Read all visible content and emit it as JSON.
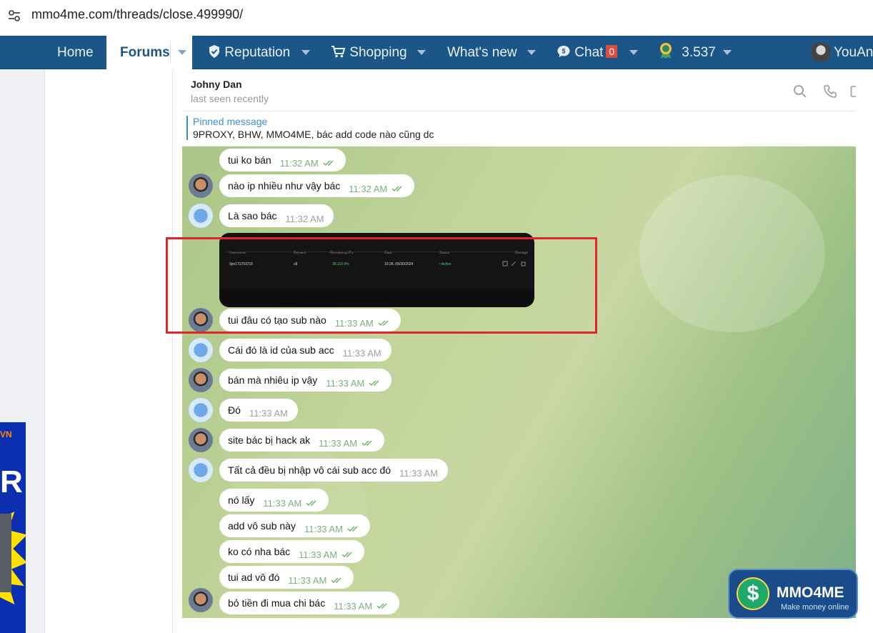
{
  "browser": {
    "url": "mmo4me.com/threads/close.499990/"
  },
  "nav": {
    "home": "Home",
    "forums": "Forums",
    "reputation": "Reputation",
    "shopping": "Shopping",
    "whats_new": "What's new",
    "chat": "Chat",
    "chat_count": "0",
    "points": "3.537",
    "user": "YouAn"
  },
  "ad": {
    "tag": "VN",
    "letter": "R"
  },
  "telegram": {
    "contact_name": "Johny Dan",
    "status": "last seen recently",
    "pinned_title": "Pinned message",
    "pinned_text": "9PROXY, BHW, MMO4ME, bác add code nào cũng dc"
  },
  "screenshot_table": {
    "headers": [
      "Username",
      "Remark",
      "Remaining IPs",
      "Date",
      "Status",
      "Manage"
    ],
    "row": [
      "9px171703716",
      "c8",
      "38,110 IPs",
      "10:28, 05/30/2024",
      "• Active",
      ""
    ]
  },
  "messages": [
    {
      "text": "tui ko bán",
      "time": "11:32 AM",
      "dir": "out"
    },
    {
      "text": "nào ip nhiều như vậy bác",
      "time": "11:32 AM",
      "dir": "out"
    },
    {
      "text": "Là sao bác",
      "time": "11:32 AM",
      "dir": "in"
    },
    {
      "text": "tui đâu có tạo sub nào",
      "time": "11:33 AM",
      "dir": "out"
    },
    {
      "text": "Cái đó là id của sub acc",
      "time": "11:33 AM",
      "dir": "in"
    },
    {
      "text": "bán mà nhiêu ip vậy",
      "time": "11:33 AM",
      "dir": "out"
    },
    {
      "text": "Đó",
      "time": "11:33 AM",
      "dir": "in"
    },
    {
      "text": "site bác bị hack ak",
      "time": "11:33 AM",
      "dir": "out"
    },
    {
      "text": "Tất cả đều bị nhập vô cái sub acc đó",
      "time": "11:33 AM",
      "dir": "in"
    },
    {
      "text": "nó lấy",
      "time": "11:33 AM",
      "dir": "out"
    },
    {
      "text": "add vô sub này",
      "time": "11:33 AM",
      "dir": "out"
    },
    {
      "text": "ko có nha bác",
      "time": "11:33 AM",
      "dir": "out"
    },
    {
      "text": "tui ad vô đó",
      "time": "11:33 AM",
      "dir": "out"
    },
    {
      "text": "bỏ tiền đi mua chi bác",
      "time": "11:33 AM",
      "dir": "out"
    }
  ],
  "logo": {
    "brand": "MMO4ME",
    "tagline": "Make money online"
  },
  "colors": {
    "nav_bg": "#1c5587",
    "highlight_box": "#e2242b",
    "read_ticks": "#6fb36f"
  }
}
